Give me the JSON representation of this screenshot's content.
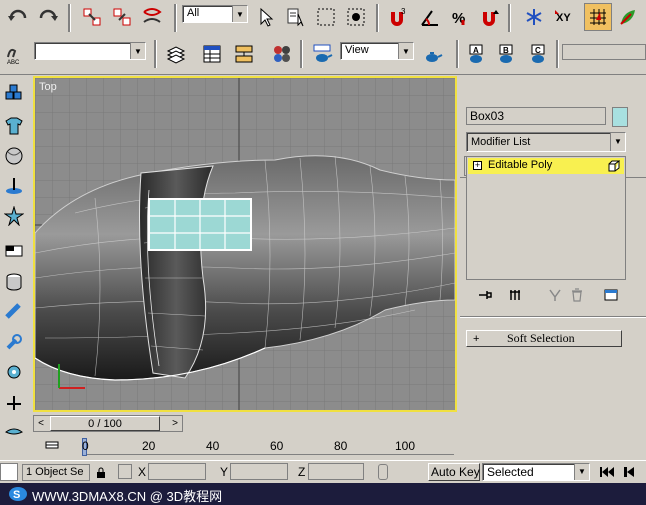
{
  "main_toolbar": {
    "selection_filter": "All"
  },
  "second_toolbar": {
    "named_selection": "",
    "coord_system": "View"
  },
  "viewport": {
    "label": "Top"
  },
  "command_panel": {
    "object_name": "Box03",
    "object_color": "#a8e0e0",
    "modifier_list_label": "Modifier List",
    "stack_item": "Editable Poly",
    "soft_selection_label": "Soft Selection",
    "soft_selection_sign": "+"
  },
  "time_slider": {
    "frame_label": "0 / 100",
    "ticks": [
      "0",
      "20",
      "40",
      "60",
      "80",
      "100"
    ]
  },
  "status_bar": {
    "selection_count": "1 Object Se",
    "x_label": "X",
    "y_label": "Y",
    "z_label": "Z",
    "auto_key": "Auto Key",
    "selected_dropdown": "Selected"
  },
  "watermark": {
    "text": "WWW.3DMAX8.CN @ 3D教程网"
  },
  "colors": {
    "viewport_border": "#f0e040",
    "stack_highlight": "#f8f050",
    "selection_poly": "#9cd8d4"
  }
}
